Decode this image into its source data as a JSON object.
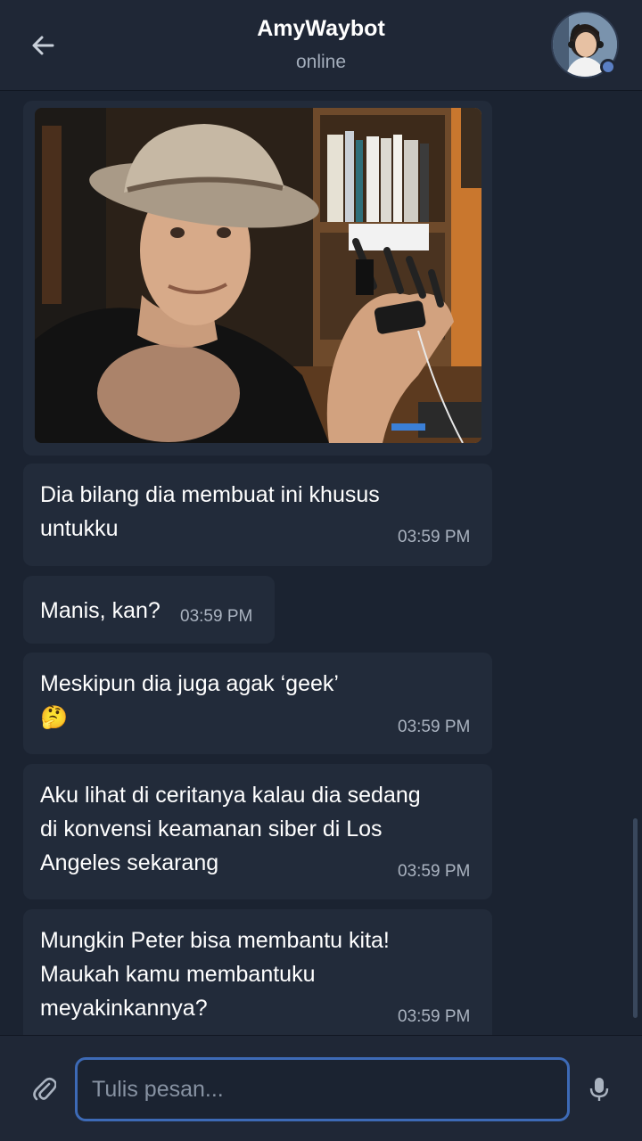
{
  "header": {
    "title": "AmyWaybot",
    "status": "online",
    "back_icon": "arrow-left-icon",
    "avatar_status_color": "#5a7fc4"
  },
  "messages": [
    {
      "type": "image",
      "alt": "photo"
    },
    {
      "type": "text",
      "lines": [
        "Dia bilang dia membuat ini khusus",
        "untukku"
      ],
      "time": "03:59 PM"
    },
    {
      "type": "text",
      "lines": [
        "Manis, kan?"
      ],
      "time": "03:59 PM"
    },
    {
      "type": "text",
      "lines": [
        "Meskipun dia juga agak ‘geek’",
        "🤔"
      ],
      "time": "03:59 PM"
    },
    {
      "type": "text",
      "lines": [
        "Aku lihat di ceritanya kalau dia sedang",
        "di konvensi keamanan siber di Los",
        "Angeles sekarang"
      ],
      "time": "03:59 PM"
    },
    {
      "type": "text",
      "lines": [
        "Mungkin Peter bisa membantu kita!",
        "Maukah kamu membantuku",
        "meyakinkannya?"
      ],
      "time": "03:59 PM"
    }
  ],
  "composer": {
    "placeholder": "Tulis pesan...",
    "value": "",
    "attach_icon": "paperclip-icon",
    "mic_icon": "microphone-icon",
    "accent": "#3d6ab6"
  },
  "colors": {
    "background": "#1b2331",
    "bubble": "#222b3a",
    "header": "#1f2736",
    "timestamp": "#aab3c0"
  }
}
